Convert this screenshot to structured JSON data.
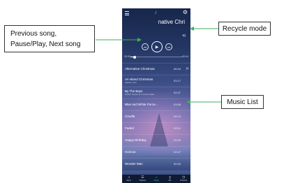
{
  "app": {
    "title": "Alternative Christmas",
    "title_visible": "native Chri",
    "accent_color": "#3fcf8e"
  },
  "player": {
    "current_time": "00:00",
    "total_time": "00:44",
    "progress": 0.08,
    "prev_icon": "skip-previous",
    "play_icon": "play",
    "next_icon": "skip-next",
    "repeat_icon": "repeat-loop"
  },
  "songs": [
    {
      "title": "Alternative Christmas",
      "artist": "",
      "duration": "00:44",
      "tag": "µ"
    },
    {
      "title": "An Island Christmas",
      "artist": "Sophie Lane",
      "duration": "01:17",
      "tag": ""
    },
    {
      "title": "By The Bays",
      "artist": "Harbor Sessions & Ocean Walk",
      "duration": "02:47",
      "tag": ""
    },
    {
      "title": "Blue and White Porce...",
      "artist": "",
      "duration": "01:56",
      "tag": ""
    },
    {
      "title": "Cruella",
      "artist": "",
      "duration": "02:10",
      "tag": ""
    },
    {
      "title": "Faded",
      "artist": "",
      "duration": "02:01",
      "tag": ""
    },
    {
      "title": "Happy Birthday",
      "artist": "",
      "duration": "00:39",
      "tag": ""
    },
    {
      "title": "Horizon",
      "artist": "",
      "duration": "02:47",
      "tag": ""
    },
    {
      "title": "Wonder Man",
      "artist": "",
      "duration": "00:40",
      "tag": ""
    }
  ],
  "nav": [
    {
      "label": "Music",
      "icon": "music-icon",
      "glyph": "♫",
      "active": false
    },
    {
      "label": "Playlists",
      "icon": "list-icon",
      "glyph": "☰",
      "active": false
    },
    {
      "label": "Songs",
      "icon": "note-icon",
      "glyph": "♪",
      "active": true
    },
    {
      "label": "Mic",
      "icon": "mic-icon",
      "glyph": "ɣ",
      "active": false
    },
    {
      "label": "Schedule",
      "icon": "clock-icon",
      "glyph": "◷",
      "active": false
    }
  ],
  "annotations": {
    "controls": "Previous song, Pause/Play, Next song",
    "recycle": "Recycle mode",
    "music_list": "Music List"
  }
}
